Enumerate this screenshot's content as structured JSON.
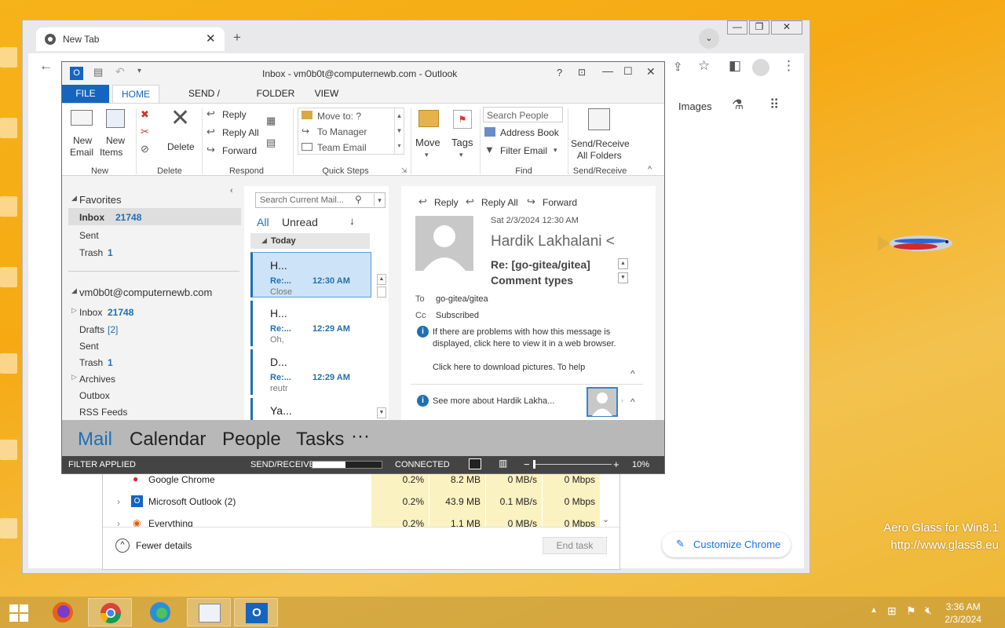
{
  "watermark": {
    "line1": "Aero Glass for Win8.1",
    "line2": "http://www.glass8.eu"
  },
  "chrome": {
    "tab_title": "New Tab",
    "images_link": "Images",
    "customize_button": "Customize Chrome"
  },
  "task_manager": {
    "rows": [
      {
        "name": "Google Chrome",
        "cpu": "0.2%",
        "memory": "8.2 MB",
        "disk": "0 MB/s",
        "network": "0 Mbps"
      },
      {
        "name": "Microsoft Outlook (2)",
        "cpu": "0.2%",
        "memory": "43.9 MB",
        "disk": "0.1 MB/s",
        "network": "0 Mbps"
      },
      {
        "name": "Everything",
        "cpu": "0.2%",
        "memory": "1.1 MB",
        "disk": "0 MB/s",
        "network": "0 Mbps"
      }
    ],
    "fewer_details": "Fewer details",
    "end_task": "End task"
  },
  "outlook": {
    "title": "Inbox - vm0b0t@computernewb.com - Outlook",
    "tabs": [
      "FILE",
      "HOME",
      "SEND / RECEIVE",
      "FOLDER",
      "VIEW"
    ],
    "ribbon": {
      "new_email": [
        "New",
        "Email"
      ],
      "new_items": [
        "New",
        "Items"
      ],
      "delete": "Delete",
      "reply": "Reply",
      "reply_all": "Reply All",
      "forward": "Forward",
      "quick_steps": [
        "Move to: ?",
        "To Manager",
        "Team Email"
      ],
      "move": "Move",
      "tags": "Tags",
      "search_people": "Search People",
      "address_book": "Address Book",
      "filter_email": "Filter Email",
      "send_receive": [
        "Send/Receive",
        "All Folders"
      ],
      "groups": [
        "New",
        "Delete",
        "Respond",
        "Quick Steps",
        "Move",
        "Find",
        "Send/Receive"
      ]
    },
    "nav": {
      "favorites": "Favorites",
      "fav_items": [
        {
          "label": "Inbox",
          "count": "21748"
        },
        {
          "label": "Sent",
          "count": ""
        },
        {
          "label": "Trash",
          "count": "1"
        }
      ],
      "account": "vm0b0t@computernewb.com",
      "acct_items": [
        {
          "label": "Inbox",
          "count": "21748"
        },
        {
          "label": "Drafts",
          "count": "[2]"
        },
        {
          "label": "Sent",
          "count": ""
        },
        {
          "label": "Trash",
          "count": "1"
        },
        {
          "label": "Archives",
          "count": ""
        },
        {
          "label": "Outbox",
          "count": ""
        },
        {
          "label": "RSS Feeds",
          "count": ""
        }
      ]
    },
    "list": {
      "search_placeholder": "Search Current Mail...",
      "filter_all": "All",
      "filter_unread": "Unread",
      "group_today": "Today",
      "messages": [
        {
          "from": "H...",
          "subject": "Re:...",
          "time": "12:30 AM",
          "preview": "Close"
        },
        {
          "from": "H...",
          "subject": "Re:...",
          "time": "12:29 AM",
          "preview": "Oh,"
        },
        {
          "from": "D...",
          "subject": "Re:...",
          "time": "12:29 AM",
          "preview": "reutr"
        },
        {
          "from": "Ya...",
          "subject": "",
          "time": "",
          "preview": ""
        }
      ]
    },
    "reading": {
      "reply": "Reply",
      "reply_all": "Reply All",
      "forward": "Forward",
      "date": "Sat 2/3/2024 12:30 AM",
      "sender": "Hardik Lakhalani <",
      "subject_line1": "Re: [go-gitea/gitea]",
      "subject_line2": "Comment types",
      "to_label": "To",
      "to_value": "go-gitea/gitea",
      "cc_label": "Cc",
      "cc_value": "Subscribed",
      "info_text": "If there are problems with how this message is displayed, click here to view it in a web browser.",
      "download_text": "Click here to download pictures. To help",
      "see_more": "See more about Hardik Lakha..."
    },
    "bottom_nav": [
      "Mail",
      "Calendar",
      "People",
      "Tasks",
      "···"
    ],
    "status": {
      "filter": "FILTER APPLIED",
      "send_receive": "SEND/RECEIVE",
      "send_receive_progress": 0.48,
      "connected": "CONNECTED",
      "zoom": "10%"
    }
  },
  "taskbar": {
    "time": "3:36 AM",
    "date": "2/3/2024"
  }
}
